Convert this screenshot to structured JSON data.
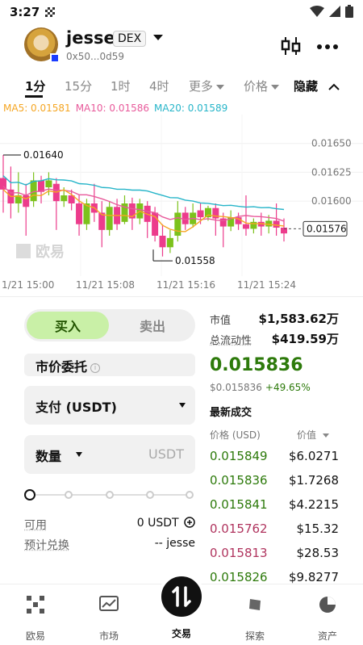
{
  "status": {
    "time": "3:27"
  },
  "header": {
    "username": "jesse",
    "badge": "DEX",
    "address": "0x50...0d59"
  },
  "tabs": [
    "1分",
    "15分",
    "1时",
    "4时",
    "更多",
    "价格",
    "隐藏"
  ],
  "ma": {
    "ma5": "MA5: 0.01581",
    "ma10": "MA10: 0.01586",
    "ma20": "MA20: 0.01589",
    "colors": {
      "ma5": "#f5a623",
      "ma10": "#e85a9b",
      "ma20": "#27b5c9"
    }
  },
  "chart_data": {
    "type": "candlestick",
    "y_ticks": [
      "0.01650",
      "0.01625",
      "0.01600",
      "0.01576"
    ],
    "ylim": [
      0.01535,
      0.01675
    ],
    "current_price_label": "0.01576",
    "annotations": {
      "high": "0.01640",
      "low": "0.01558"
    },
    "x_ticks": [
      "1/21 15:00",
      "11/21 15:08",
      "11/21 15:16",
      "11/21 15:24"
    ],
    "watermark": "欧易",
    "up_color": "#7cc21c",
    "down_color": "#ec3c8c",
    "candles": [
      {
        "o": 0.0162,
        "c": 0.0161,
        "h": 0.0164,
        "l": 0.0159
      },
      {
        "o": 0.0161,
        "c": 0.01598,
        "h": 0.0163,
        "l": 0.01585
      },
      {
        "o": 0.01598,
        "c": 0.01605,
        "h": 0.01625,
        "l": 0.0159
      },
      {
        "o": 0.01605,
        "c": 0.01595,
        "h": 0.01615,
        "l": 0.0157
      },
      {
        "o": 0.016,
        "c": 0.01618,
        "h": 0.01625,
        "l": 0.01595
      },
      {
        "o": 0.01618,
        "c": 0.01608,
        "h": 0.01622,
        "l": 0.01598
      },
      {
        "o": 0.01612,
        "c": 0.01618,
        "h": 0.01625,
        "l": 0.01605
      },
      {
        "o": 0.01615,
        "c": 0.016,
        "h": 0.0162,
        "l": 0.01575
      },
      {
        "o": 0.016,
        "c": 0.01605,
        "h": 0.01612,
        "l": 0.01595
      },
      {
        "o": 0.01605,
        "c": 0.01598,
        "h": 0.0161,
        "l": 0.01592
      },
      {
        "o": 0.01598,
        "c": 0.0158,
        "h": 0.01605,
        "l": 0.0157
      },
      {
        "o": 0.0158,
        "c": 0.01598,
        "h": 0.01602,
        "l": 0.01575
      },
      {
        "o": 0.01598,
        "c": 0.0159,
        "h": 0.01615,
        "l": 0.01582
      },
      {
        "o": 0.0159,
        "c": 0.01575,
        "h": 0.016,
        "l": 0.0156
      },
      {
        "o": 0.01575,
        "c": 0.01595,
        "h": 0.016,
        "l": 0.0157
      },
      {
        "o": 0.01595,
        "c": 0.0158,
        "h": 0.01602,
        "l": 0.01575
      },
      {
        "o": 0.01582,
        "c": 0.01598,
        "h": 0.01605,
        "l": 0.0158
      },
      {
        "o": 0.01598,
        "c": 0.01585,
        "h": 0.01603,
        "l": 0.01575
      },
      {
        "o": 0.01585,
        "c": 0.01598,
        "h": 0.01602,
        "l": 0.0158
      },
      {
        "o": 0.01596,
        "c": 0.01582,
        "h": 0.016,
        "l": 0.01568
      },
      {
        "o": 0.0159,
        "c": 0.0157,
        "h": 0.01595,
        "l": 0.01565
      },
      {
        "o": 0.0157,
        "c": 0.0156,
        "h": 0.0158,
        "l": 0.01552
      },
      {
        "o": 0.0156,
        "c": 0.01568,
        "h": 0.01575,
        "l": 0.01555
      },
      {
        "o": 0.0157,
        "c": 0.0159,
        "h": 0.016,
        "l": 0.01565
      },
      {
        "o": 0.0159,
        "c": 0.0158,
        "h": 0.01595,
        "l": 0.01575
      },
      {
        "o": 0.0158,
        "c": 0.0159,
        "h": 0.01598,
        "l": 0.01577
      },
      {
        "o": 0.01592,
        "c": 0.01586,
        "h": 0.01598,
        "l": 0.0158
      },
      {
        "o": 0.01586,
        "c": 0.01594,
        "h": 0.01596,
        "l": 0.01583
      },
      {
        "o": 0.01594,
        "c": 0.01585,
        "h": 0.01598,
        "l": 0.0157
      },
      {
        "o": 0.01585,
        "c": 0.01578,
        "h": 0.0159,
        "l": 0.0156
      },
      {
        "o": 0.01578,
        "c": 0.01586,
        "h": 0.01592,
        "l": 0.01574
      },
      {
        "o": 0.01586,
        "c": 0.0158,
        "h": 0.0159,
        "l": 0.01575
      },
      {
        "o": 0.0158,
        "c": 0.01576,
        "h": 0.01605,
        "l": 0.0157
      },
      {
        "o": 0.01576,
        "c": 0.01582,
        "h": 0.01585,
        "l": 0.01572
      },
      {
        "o": 0.01582,
        "c": 0.01578,
        "h": 0.0159,
        "l": 0.0157
      },
      {
        "o": 0.01578,
        "c": 0.01583,
        "h": 0.01588,
        "l": 0.01572
      },
      {
        "o": 0.01583,
        "c": 0.01577,
        "h": 0.01598,
        "l": 0.0157
      },
      {
        "o": 0.01577,
        "c": 0.01572,
        "h": 0.01585,
        "l": 0.01565
      }
    ]
  },
  "order": {
    "buy": "买入",
    "sell": "卖出",
    "type": "市价委托",
    "pay": "支付 (USDT)",
    "qty_label": "数量",
    "qty_unit": "USDT",
    "available_label": "可用",
    "available_value": "0 USDT",
    "estimate_label": "预计兑换",
    "estimate_value": "-- jesse"
  },
  "market": {
    "mcap_label": "市值",
    "mcap_value": "$1,583.62万",
    "float_label": "总流动性",
    "float_value": "$419.59万",
    "price": "0.015836",
    "price_usd": "$0.015836",
    "change": "+49.65%",
    "trades_title": "最新成交",
    "col_price": "价格 (USD)",
    "col_value": "价值",
    "trades": [
      {
        "price": "0.015849",
        "value": "$6.0271",
        "side": "buy"
      },
      {
        "price": "0.015836",
        "value": "$1.7268",
        "side": "buy"
      },
      {
        "price": "0.015841",
        "value": "$4.2215",
        "side": "buy"
      },
      {
        "price": "0.015762",
        "value": "$15.32",
        "side": "sell"
      },
      {
        "price": "0.015813",
        "value": "$28.53",
        "side": "sell"
      },
      {
        "price": "0.015826",
        "value": "$9.8277",
        "side": "buy"
      }
    ],
    "buy_color": "#2d7a0b",
    "sell_color": "#b0345e"
  },
  "nav": {
    "home": "欧易",
    "market": "市场",
    "trade": "交易",
    "discover": "探索",
    "assets": "资产"
  }
}
